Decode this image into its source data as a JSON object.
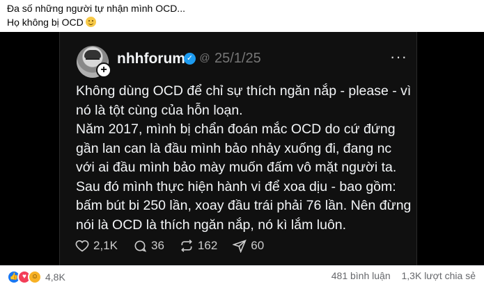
{
  "caption": {
    "line1": "Đa số những người tự nhận mình OCD...",
    "line2": "Họ không bị OCD"
  },
  "thread_post": {
    "username": "nhhforum",
    "date": "25/1/25",
    "paragraphs": [
      "Không dùng OCD để chỉ sự thích ngăn nắp - please - vì nó là tột cùng của hỗn loạn.",
      "Năm 2017, mình bị chẩn đoán mắc OCD do cứ đứng gần lan can là đầu mình bảo nhảy xuống đi, đang nc với ai đầu mình bảo mày muốn đấm vô mặt người ta. Sau đó mình thực hiện hành vi để xoa dịu - bao gồm: bấm bút bi 250 lần, xoay đầu trái phải 76 lần. Nên đừng nói là OCD là thích ngăn nắp, nó kì lắm luôn."
    ],
    "stats": {
      "likes": "2,1K",
      "comments": "36",
      "reposts": "162",
      "shares": "60"
    }
  },
  "footer": {
    "reactions_count": "4,8K",
    "comments": "481 bình luận",
    "shares": "1,3K lượt chia sẻ"
  },
  "icons": [
    "heart-icon",
    "comment-icon",
    "repost-icon",
    "share-icon",
    "verified-icon",
    "more-icon"
  ]
}
